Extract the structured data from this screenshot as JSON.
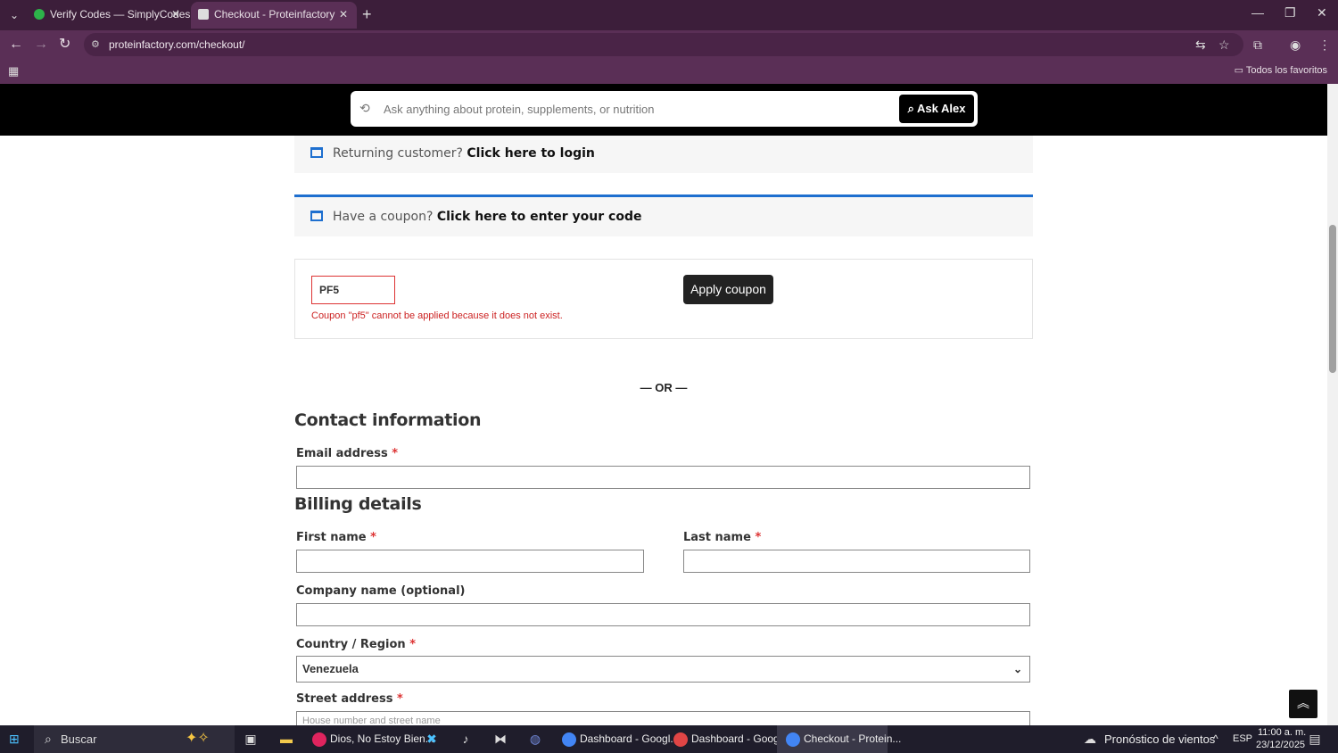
{
  "browser": {
    "tabs": [
      {
        "title": "Verify Codes — SimplyCodes",
        "favicon_color": "#2db34a"
      },
      {
        "title": "Checkout - Proteinfactory",
        "favicon_color": "#dddddd"
      }
    ],
    "url": "proteinfactory.com/checkout/",
    "bookmarks_right": "Todos los favoritos"
  },
  "site": {
    "ask_placeholder": "Ask anything about protein, supplements, or nutrition",
    "ask_button": "Ask Alex"
  },
  "notices": {
    "returning_prefix": "Returning customer?",
    "returning_link": "Click here to login",
    "coupon_prefix": "Have a coupon?",
    "coupon_link": "Click here to enter your code"
  },
  "coupon": {
    "value": "PF5",
    "error": "Coupon \"pf5\" cannot be applied because it does not exist.",
    "apply_label": "Apply coupon"
  },
  "or_divider": "— OR —",
  "contact": {
    "heading": "Contact information",
    "email_label": "Email address",
    "required": "*"
  },
  "billing": {
    "heading": "Billing details",
    "first_name_label": "First name",
    "last_name_label": "Last name",
    "company_label": "Company name (optional)",
    "country_label": "Country / Region",
    "country_value": "Venezuela",
    "street_label": "Street address",
    "street_placeholder": "House number and street name"
  },
  "taskbar": {
    "search": "Buscar",
    "apps": [
      {
        "label": "Dios, No Estoy Bien...",
        "color": "#e0245e"
      },
      {
        "label": "Dashboard - Googl...",
        "color": "#4285f4"
      },
      {
        "label": "Dashboard - Googl...",
        "color": "#e04545"
      },
      {
        "label": "Checkout - Protein...",
        "color": "#4285f4"
      }
    ],
    "weather": "Pronóstico de vientos",
    "lang": "ESP",
    "time": "11:00 a. m.",
    "date": "23/12/2025"
  }
}
